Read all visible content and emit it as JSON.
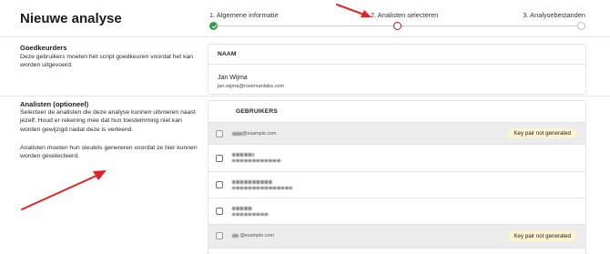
{
  "header": {
    "title": "Nieuwe analyse"
  },
  "stepper": {
    "steps": [
      {
        "label": "1. Algemene informatie",
        "state": "done"
      },
      {
        "label": "2. Analisten selecteren",
        "state": "active"
      },
      {
        "label": "3. Analysebestanden",
        "state": "upcoming"
      }
    ]
  },
  "approvers": {
    "title": "Goedkeurders",
    "description": "Deze gebruikers moeten het script goedkeuren voordat het kan worden uitgevoerd.",
    "column_header": "NAAM",
    "person": {
      "name": "Jan Wijma",
      "email": "jan.wijma@rosemanlabs.com"
    }
  },
  "analysts": {
    "title": "Analisten (optioneel)",
    "description_1": "Selecteer de analisten die deze analyse kunnen uitvoeren naast jezelf. Houd er rekening mee dat hun toestemming niet kan worden gewijzigd nadat deze is verleend.",
    "description_2": "Analisten moeten hun sleutels genereren voordat ze hier kunnen worden geselecteerd.",
    "column_header": "GEBRUIKERS",
    "rows": [
      {
        "email": "@example.com",
        "badge": "Key pair not generated"
      },
      {
        "email": "",
        "badge": ""
      },
      {
        "email": "",
        "badge": ""
      },
      {
        "email": "",
        "badge": ""
      },
      {
        "email": "@example.com",
        "badge": "Key pair not generated"
      }
    ]
  },
  "colors": {
    "accent": "#b0173a",
    "success": "#2e9e4a",
    "badge_bg": "#fff3d1",
    "annotation_arrow": "#e32222"
  }
}
